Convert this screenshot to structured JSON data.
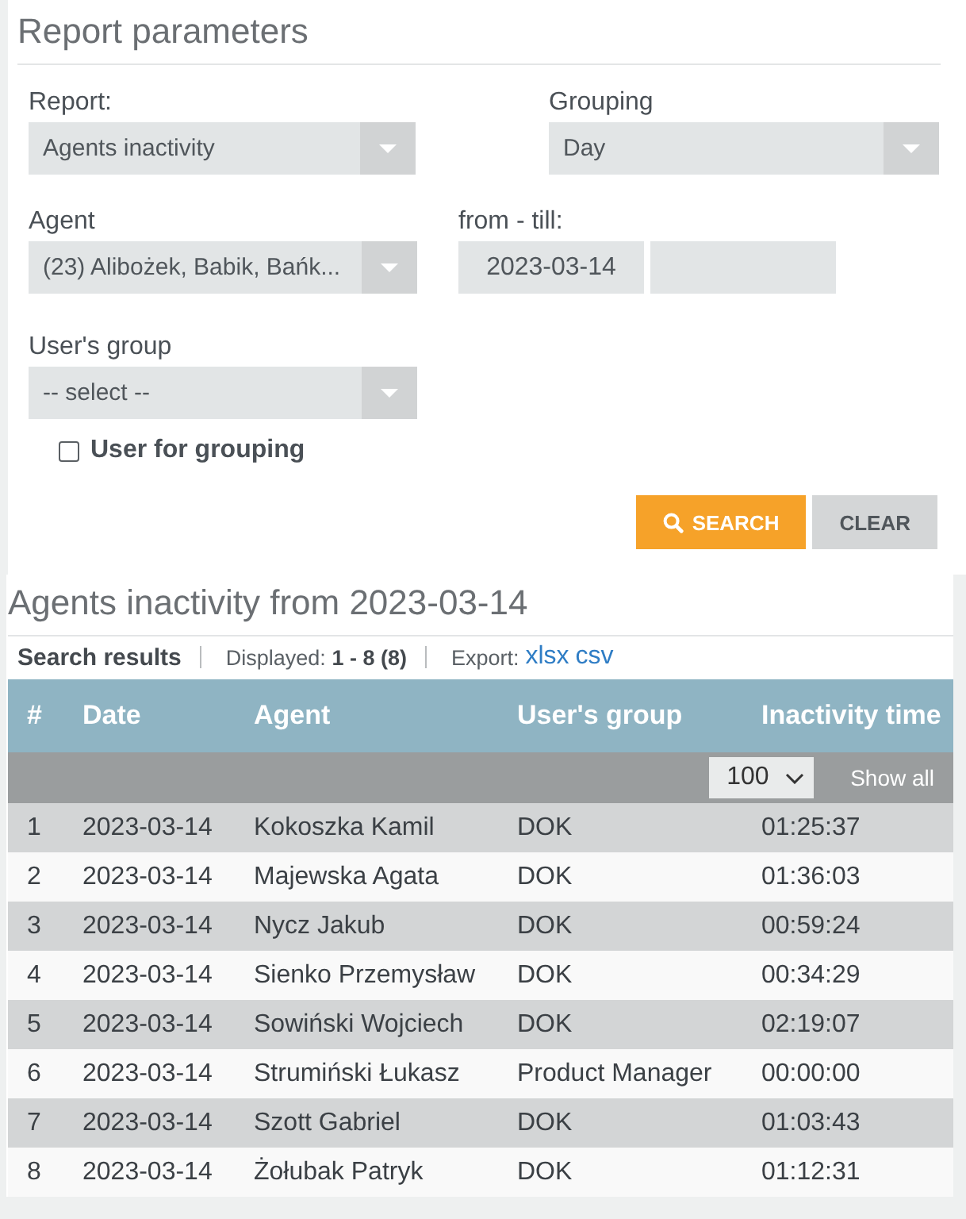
{
  "report_parameters": {
    "title": "Report parameters",
    "rows": [
      [
        {
          "kind": "select",
          "label": "Report:",
          "value": "Agents inactivity"
        },
        {
          "kind": "select",
          "label": "Grouping",
          "value": "Day"
        }
      ],
      [
        {
          "kind": "select",
          "label": "Agent",
          "value": "(23) Alibożek, Babik, Bańk..."
        },
        {
          "kind": "date_range",
          "label": "from - till:",
          "from": "2023-03-14"
        }
      ],
      [
        {
          "kind": "select",
          "label": "User's group",
          "placeholder": "-- select --"
        }
      ]
    ],
    "checkbox": {
      "label": "User for grouping",
      "checked": false
    },
    "buttons": [
      {
        "kind": "primary",
        "label": "SEARCH"
      },
      {
        "kind": "secondary",
        "label": "CLEAR"
      }
    ]
  },
  "results": {
    "title": "Agents inactivity from 2023-03-14",
    "summary": {
      "label": "Search results",
      "displayed": "Displayed: **1 - 8 (8)**",
      "export_label": "Export:",
      "export_links": [
        "xlsx",
        "csv"
      ]
    },
    "table": {
      "columns": [
        "#",
        "Date",
        "Agent",
        "User's group",
        "Inactivity time"
      ],
      "page_size": "100",
      "show_all": "Show all",
      "rows": [
        [
          "1",
          "2023-03-14",
          "Kokoszka Kamil",
          "DOK",
          "01:25:37"
        ],
        [
          "2",
          "2023-03-14",
          "Majewska Agata",
          "DOK",
          "01:36:03"
        ],
        [
          "3",
          "2023-03-14",
          "Nycz Jakub",
          "DOK",
          "00:59:24"
        ],
        [
          "4",
          "2023-03-14",
          "Sienko Przemysław",
          "DOK",
          "00:34:29"
        ],
        [
          "5",
          "2023-03-14",
          "Sowiński Wojciech",
          "DOK",
          "02:19:07"
        ],
        [
          "6",
          "2023-03-14",
          "Strumiński Łukasz",
          "Product Manager",
          "00:00:00"
        ],
        [
          "7",
          "2023-03-14",
          "Szott Gabriel",
          "DOK",
          "01:03:43"
        ],
        [
          "8",
          "2023-03-14",
          "Żołubak Patryk",
          "DOK",
          "01:12:31"
        ]
      ]
    }
  }
}
